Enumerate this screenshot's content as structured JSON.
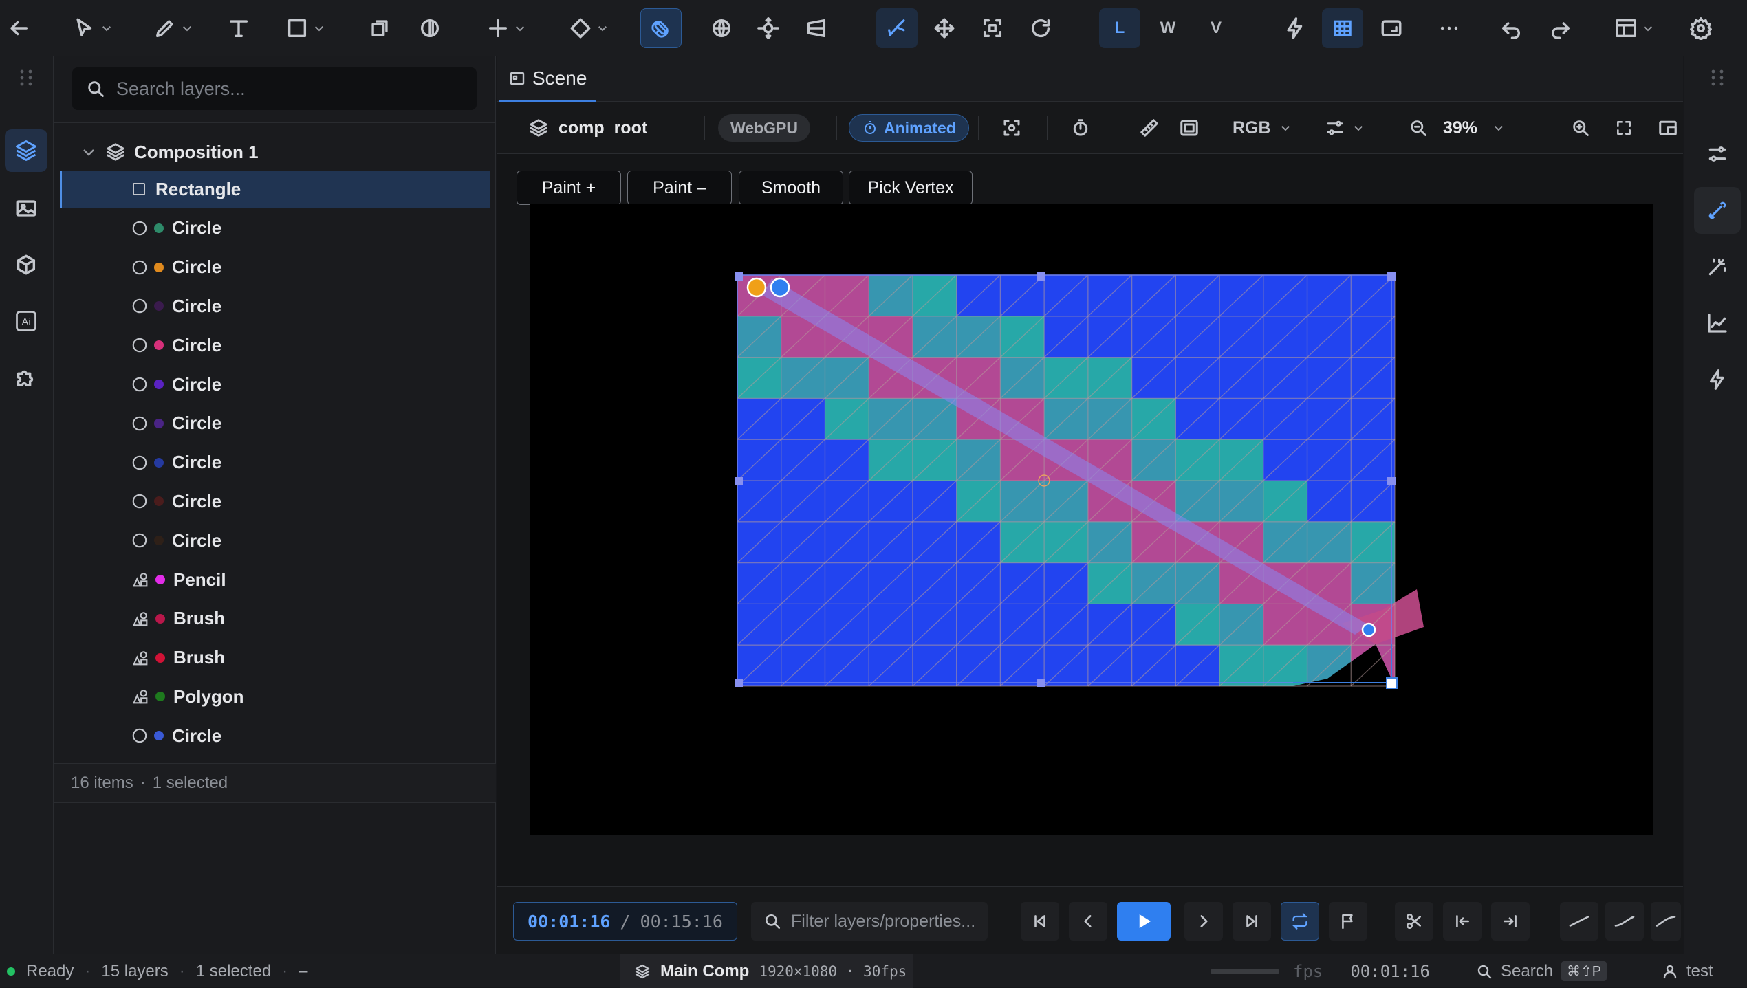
{
  "toolbar": {
    "modes": [
      "L",
      "W",
      "V"
    ],
    "icons": [
      "back-arrow-icon",
      "select-icon",
      "pen-icon",
      "text-icon",
      "rectangle-icon",
      "transform-icon",
      "mask-icon",
      "add-icon",
      "keyframe-icon",
      "magnet-icon",
      "globe-icon",
      "orbit-icon",
      "perspective-icon",
      "path-icon",
      "move-icon",
      "bounds-icon",
      "rotate-icon",
      "lightning-icon",
      "grid-icon",
      "resize-icon",
      "more-icon",
      "undo-icon",
      "redo-icon",
      "layout-icon",
      "settings-icon"
    ]
  },
  "layers": {
    "search_placeholder": "Search layers...",
    "group": "Composition 1",
    "items": [
      {
        "name": "Rectangle",
        "type": "rect",
        "color": null,
        "selected": true
      },
      {
        "name": "Circle",
        "type": "circle",
        "color": "#2e8b6a"
      },
      {
        "name": "Circle",
        "type": "circle",
        "color": "#e08a1e"
      },
      {
        "name": "Circle",
        "type": "circle",
        "color": "#3a1b4d"
      },
      {
        "name": "Circle",
        "type": "circle",
        "color": "#d6307a"
      },
      {
        "name": "Circle",
        "type": "circle",
        "color": "#5a22c2"
      },
      {
        "name": "Circle",
        "type": "circle",
        "color": "#4a2485"
      },
      {
        "name": "Circle",
        "type": "circle",
        "color": "#253aa0"
      },
      {
        "name": "Circle",
        "type": "circle",
        "color": "#4a1c1c"
      },
      {
        "name": "Circle",
        "type": "circle",
        "color": "#2e2018"
      },
      {
        "name": "Pencil",
        "type": "shape",
        "color": "#e22ce8"
      },
      {
        "name": "Brush",
        "type": "shape",
        "color": "#b8174a"
      },
      {
        "name": "Brush",
        "type": "shape",
        "color": "#d01236"
      },
      {
        "name": "Polygon",
        "type": "shape",
        "color": "#1e7a1e"
      },
      {
        "name": "Circle",
        "type": "circle",
        "color": "#3a5ad6"
      }
    ],
    "footer_count": "16 items",
    "footer_selected": "1 selected"
  },
  "tabs": {
    "scene": "Scene"
  },
  "scene_toolbar": {
    "comp": "comp_root",
    "renderer": "WebGPU",
    "animated": "Animated",
    "channel": "RGB",
    "zoom": "39%"
  },
  "mesh_tools": [
    "Paint +",
    "Paint –",
    "Smooth",
    "Pick Vertex"
  ],
  "playback": {
    "current": "00:01:16",
    "sep": "/",
    "total": "00:15:16",
    "filter_placeholder": "Filter layers/properties..."
  },
  "status": {
    "ready": "Ready",
    "layers": "15 layers",
    "selected": "1 selected",
    "dash": "–",
    "comp_name": "Main Comp",
    "comp_info": "1920×1080 · 30fps",
    "fps_label": "fps",
    "time": "00:01:16",
    "search": "Search",
    "shortcut": "⌘⇧P",
    "user": "test"
  },
  "colors": {
    "accent": "#2f7ff0",
    "mesh_blue": "#2244f0",
    "selection": "#203452"
  }
}
